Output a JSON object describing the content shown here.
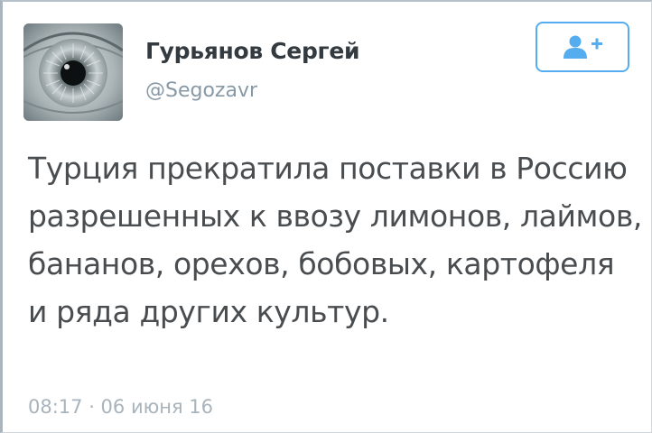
{
  "tweet": {
    "author": {
      "display_name": "Гурьянов Сергей",
      "handle": "@Segozavr",
      "avatar_icon": "eye-avatar"
    },
    "follow_button": {
      "icon": "add-user-icon",
      "color": "#55acee"
    },
    "text": "Турция прекратила поставки в Россию разрешенных к ввозу лимонов, лаймов, бананов, орехов, бобовых, картофеля и ряда других культур.",
    "timestamp": "08:17 · 06 июня 16"
  }
}
